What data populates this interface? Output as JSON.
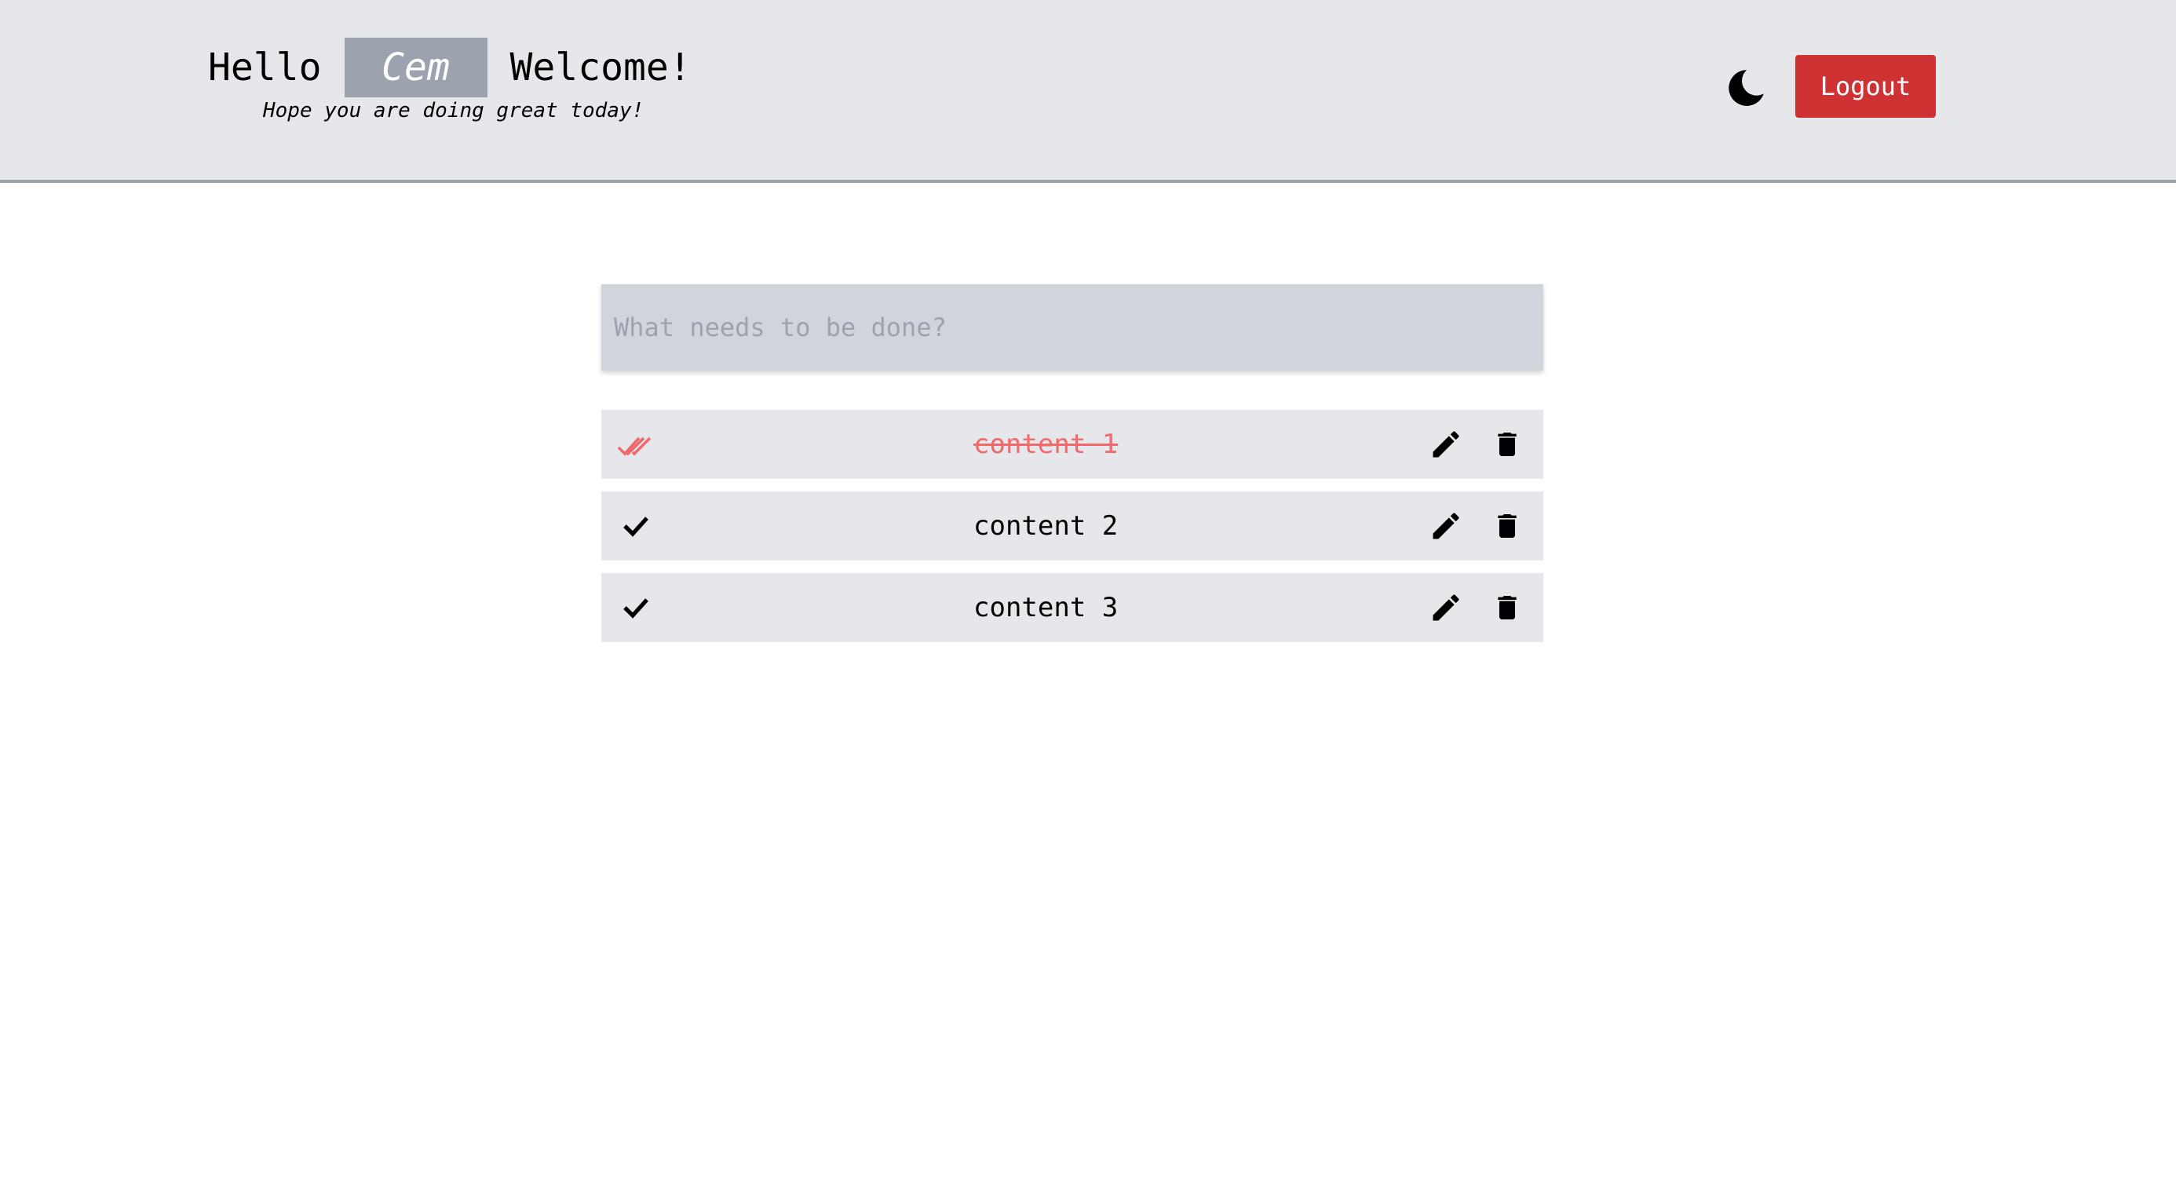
{
  "header": {
    "greeting_prefix": "Hello",
    "username": "Cem",
    "greeting_suffix": "Welcome!",
    "subtitle": "Hope you are doing great today!",
    "theme_icon": "moon-icon",
    "logout_label": "Logout"
  },
  "composer": {
    "placeholder": "What needs to be done?",
    "value": ""
  },
  "todos": [
    {
      "text": "content 1",
      "completed": true
    },
    {
      "text": "content 2",
      "completed": false
    },
    {
      "text": "content 3",
      "completed": false
    }
  ],
  "icons": {
    "complete": "double-check-icon",
    "incomplete": "check-icon",
    "edit": "pencil-icon",
    "delete": "trash-icon"
  },
  "colors": {
    "header_bg": "#e5e7eb",
    "header_border": "#9ca3af",
    "username_bg": "#9ca3af",
    "logout_bg": "#cf3232",
    "input_bg": "#d1d5db",
    "item_bg": "#e5e7eb",
    "completed_text": "#ef6b6b"
  }
}
